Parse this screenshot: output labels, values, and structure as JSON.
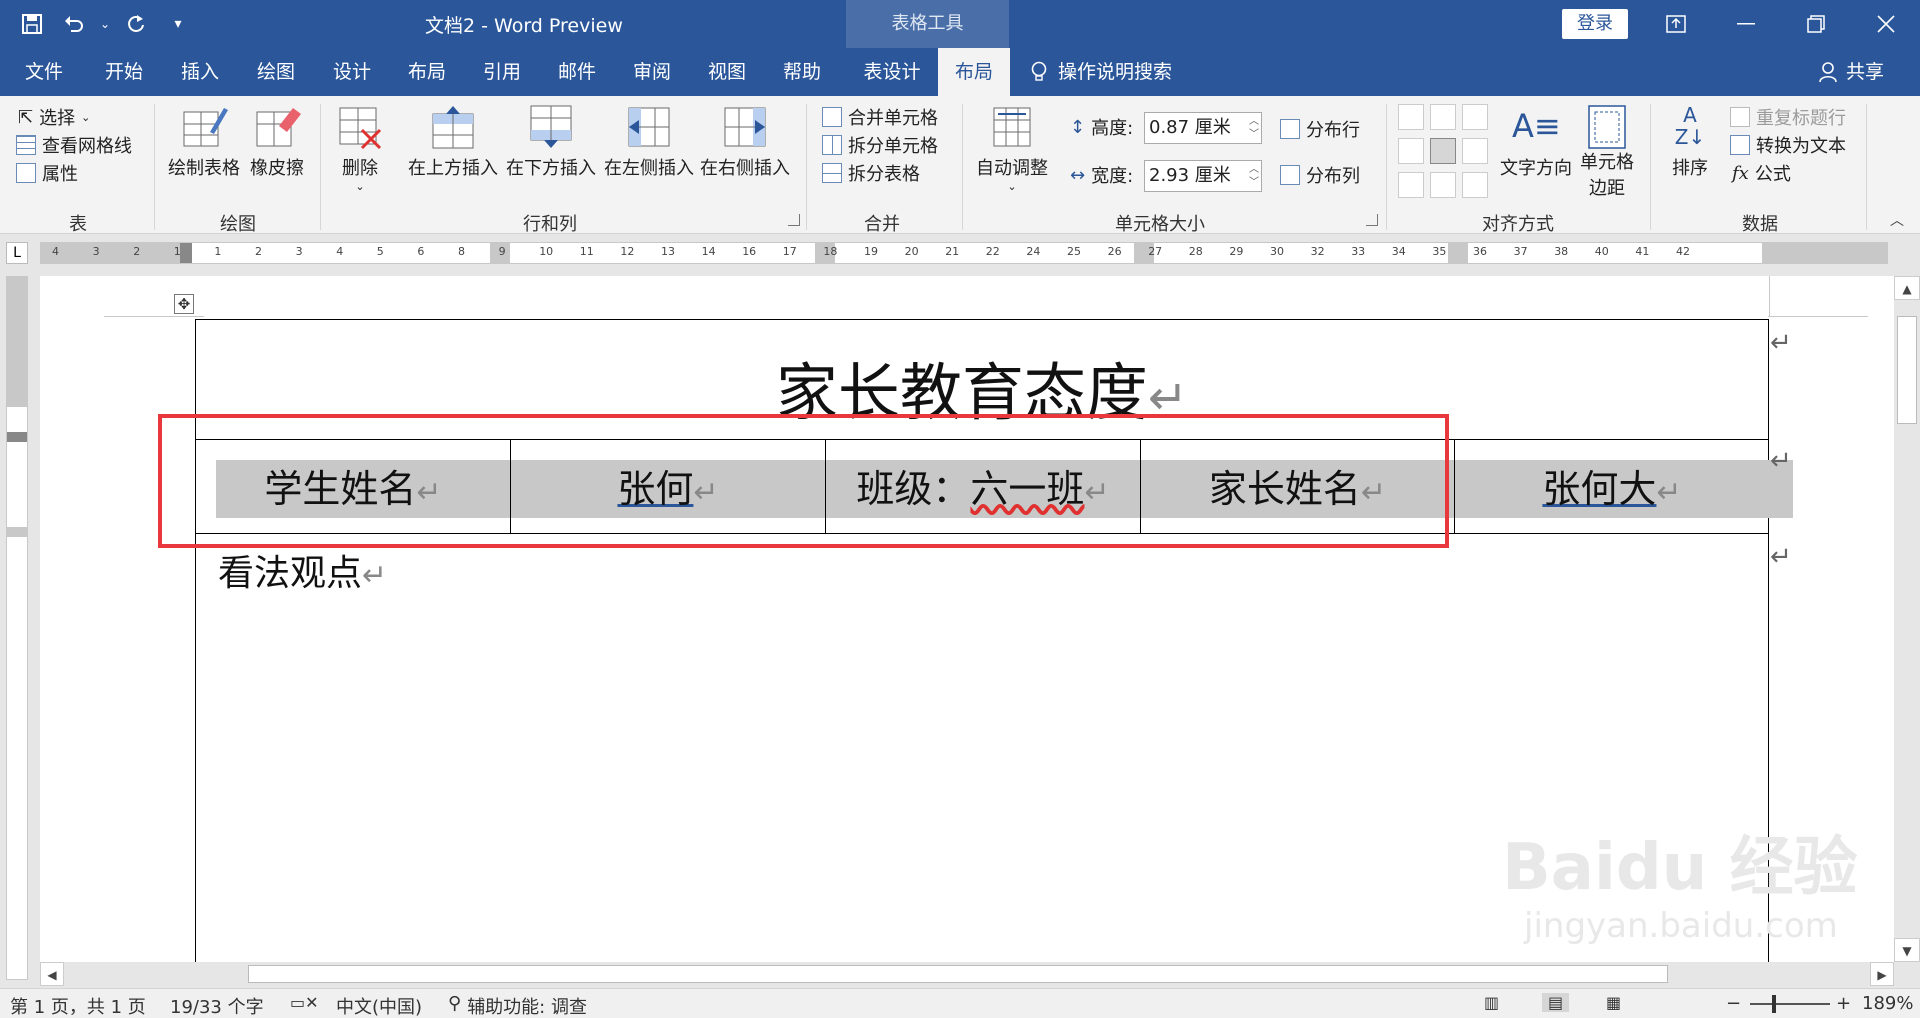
{
  "titlebar": {
    "doc_title": "文档2  -  Word Preview",
    "context_group": "表格工具",
    "login": "登录",
    "qat": [
      "save-icon",
      "undo-icon",
      "redo-icon",
      "customize-icon"
    ]
  },
  "tabs": [
    {
      "label": "文件"
    },
    {
      "label": "开始"
    },
    {
      "label": "插入"
    },
    {
      "label": "绘图"
    },
    {
      "label": "设计"
    },
    {
      "label": "布局"
    },
    {
      "label": "引用"
    },
    {
      "label": "邮件"
    },
    {
      "label": "审阅"
    },
    {
      "label": "视图"
    },
    {
      "label": "帮助"
    },
    {
      "label": "表设计"
    },
    {
      "label": "布局"
    }
  ],
  "tell_me": "操作说明搜索",
  "share": "共享",
  "ribbon": {
    "table": {
      "select": "选择",
      "gridlines": "查看网格线",
      "properties": "属性",
      "label": "表"
    },
    "draw": {
      "draw_table": "绘制表格",
      "eraser": "橡皮擦",
      "label": "绘图"
    },
    "rows_cols": {
      "delete": "删除",
      "insert_above": "在上方插入",
      "insert_below": "在下方插入",
      "insert_left": "在左侧插入",
      "insert_right": "在右侧插入",
      "label": "行和列"
    },
    "merge": {
      "merge_cells": "合并单元格",
      "split_cells": "拆分单元格",
      "split_table": "拆分表格",
      "label": "合并"
    },
    "cell_size": {
      "autofit": "自动调整",
      "height_label": "高度:",
      "height_value": "0.87 厘米",
      "width_label": "宽度:",
      "width_value": "2.93 厘米",
      "distribute_rows": "分布行",
      "distribute_cols": "分布列",
      "label": "单元格大小"
    },
    "alignment": {
      "text_direction": "文字方向",
      "cell_margins_1": "单元格",
      "cell_margins_2": "边距",
      "label": "对齐方式"
    },
    "data": {
      "sort": "排序",
      "repeat_header": "重复标题行",
      "convert": "转换为文本",
      "formula": "公式",
      "label": "数据"
    }
  },
  "ruler": {
    "numbers": [
      "4",
      "3",
      "2",
      "1",
      "1",
      "2",
      "3",
      "4",
      "5",
      "6",
      "8",
      "9",
      "10",
      "11",
      "12",
      "13",
      "14",
      "16",
      "17",
      "18",
      "19",
      "20",
      "21",
      "22",
      "24",
      "25",
      "26",
      "27",
      "28",
      "29",
      "30",
      "32",
      "33",
      "34",
      "35",
      "36",
      "37",
      "38",
      "40",
      "41",
      "42"
    ]
  },
  "document": {
    "heading": "家长教育态度",
    "cells": [
      {
        "text": "学生姓名",
        "style": "plain"
      },
      {
        "text": "张何",
        "style": "blue"
      },
      {
        "text_a": "班级：",
        "text_b": "六一班",
        "style": "red"
      },
      {
        "text": "家长姓名",
        "style": "plain"
      },
      {
        "text": "张何大",
        "style": "blue"
      }
    ],
    "body": "看法观点",
    "para_mark": "↵",
    "watermark": "Baidu 经验",
    "watermark_url": "jingyan.baidu.com"
  },
  "statusbar": {
    "page": "第 1 页，共 1 页",
    "words": "19/33 个字",
    "language": "中文(中国)",
    "accessibility": "辅助功能: 调查",
    "zoom_minus": "−",
    "zoom_plus": "+",
    "zoom": "189%"
  }
}
